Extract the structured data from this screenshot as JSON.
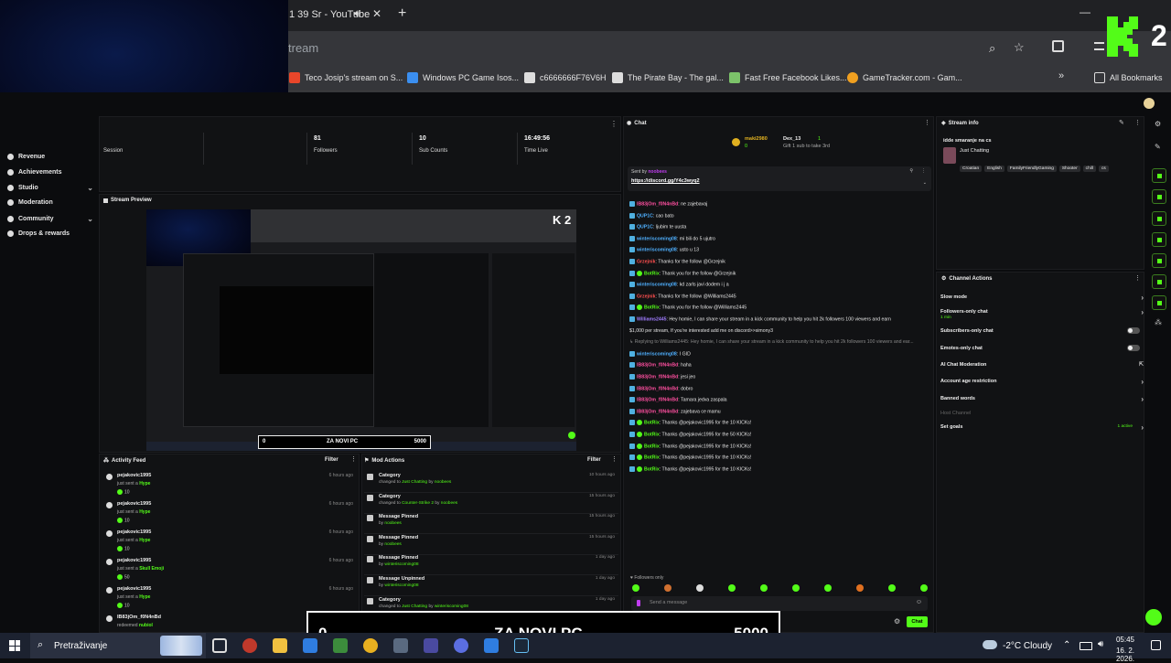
{
  "browser": {
    "tab_title": "1 39 Sr - YouTube",
    "address_partial": "tream",
    "bookmarks": [
      "Teco Josip's stream on S...",
      "Windows PC Game Isos...",
      "c6666666F76V6H",
      "The Pirate Bay - The gal...",
      "Fast Free Facebook Likes...",
      "GameTracker.com - Gam..."
    ],
    "all_bookmarks": "All Bookmarks",
    "kick_badge": "2"
  },
  "sidebar": {
    "items": [
      {
        "label": "Revenue"
      },
      {
        "label": "Achievements"
      },
      {
        "label": "Studio"
      },
      {
        "label": "Moderation"
      },
      {
        "label": "Community"
      },
      {
        "label": "Drops & rewards"
      }
    ]
  },
  "stats": {
    "session_label": "Session",
    "followers_value": "81",
    "followers_label": "Followers",
    "subs_value": "10",
    "subs_label": "Sub Counts",
    "time_value": "16:49:56",
    "time_label": "Time Live"
  },
  "preview": {
    "title": "Stream Preview",
    "overlay_left": "0",
    "overlay_mid": "ZA NOVI PC",
    "overlay_right": "5000"
  },
  "activity": {
    "title": "Activity Feed",
    "filter": "Filter",
    "items": [
      {
        "name": "pejakovic1995",
        "action": "just sent a",
        "item": "Hype",
        "amount": "10",
        "time": "6 hours ago"
      },
      {
        "name": "pejakovic1995",
        "action": "just sent a",
        "item": "Hype",
        "amount": "10",
        "time": "6 hours ago"
      },
      {
        "name": "pejakovic1995",
        "action": "just sent a",
        "item": "Hype",
        "amount": "10",
        "time": "6 hours ago"
      },
      {
        "name": "pejakovic1995",
        "action": "just sent a",
        "item": "Skull Emoji",
        "amount": "50",
        "time": "6 hours ago"
      },
      {
        "name": "pejakovic1995",
        "action": "just sent a",
        "item": "Hype",
        "amount": "10",
        "time": "6 hours ago"
      },
      {
        "name": "lB83jOm_f0N4nBd",
        "action": "redeemed",
        "item": "nubiol",
        "amount": "",
        "time": "12 hours ago"
      }
    ]
  },
  "mod_actions": {
    "title": "Mod Actions",
    "filter": "Filter",
    "items": [
      {
        "title": "Category",
        "pre": "changed to",
        "target": "Just Chatting",
        "by": "by",
        "user": "noobees",
        "time": "10 hours ago"
      },
      {
        "title": "Category",
        "pre": "changed to",
        "target": "Counter-Strike 2",
        "by": "by",
        "user": "noobees",
        "time": "15 hours ago"
      },
      {
        "title": "Message Pinned",
        "pre": "by",
        "target": "noobees",
        "by": "",
        "user": "",
        "time": "15 hours ago"
      },
      {
        "title": "Message Pinned",
        "pre": "by",
        "target": "noobees",
        "by": "",
        "user": "",
        "time": "15 hours ago"
      },
      {
        "title": "Message Pinned",
        "pre": "by",
        "target": "winteriscoming08",
        "by": "",
        "user": "",
        "time": "1 day ago"
      },
      {
        "title": "Message Unpinned",
        "pre": "by",
        "target": "winteriscoming08",
        "by": "",
        "user": "",
        "time": "1 day ago"
      },
      {
        "title": "Category",
        "pre": "changed to",
        "target": "Just Chatting",
        "by": "by",
        "user": "winteriscoming08",
        "time": "1 day ago"
      },
      {
        "title": "Category",
        "pre": "changed to",
        "target": "Counter-Strike 2",
        "by": "by",
        "user": "winteriscoming08",
        "time": "1 day ago"
      }
    ]
  },
  "chat": {
    "title": "Chat",
    "gifter_name": "maki2980",
    "gifter_count": "0",
    "gifter_name2": "Dex_13",
    "gifter_count2": "1",
    "gift_note": "Gift 1 sub to take 3rd",
    "pinned_label": "Sent by",
    "pinned_user": "noobees",
    "pinned_link": "https://discord.gg/Y4c3wyq2",
    "lines": [
      {
        "user": "lB83jOm_f0N4nBd",
        "color": "#ff4fa0",
        "text": ": ne zajebavaj"
      },
      {
        "user": "QUP1C",
        "color": "#4fb0ff",
        "text": ": cao bato"
      },
      {
        "user": "QUP1C",
        "color": "#4fb0ff",
        "text": ": ljubim te uusta"
      },
      {
        "user": "winteriscoming08",
        "color": "#4fb0ff",
        "text": ": mi bili do 5 ujutro"
      },
      {
        "user": "winteriscoming08",
        "color": "#4fb0ff",
        "text": ": usto u 13"
      },
      {
        "user": "Grzejnik",
        "color": "#ff4f4f",
        "text": ": Thanks for the follow @Grzejnik"
      },
      {
        "user": "BotRix",
        "color": "#53fc18",
        "text": ": Thank you for the follow @Grzejnik"
      },
      {
        "user": "winteriscoming08",
        "color": "#4fb0ff",
        "text": ": kd zarls javi dodem i j a"
      },
      {
        "user": "Grzejnik",
        "color": "#ff4f4f",
        "text": ": Thanks for the follow @Williams2445"
      },
      {
        "user": "BotRix",
        "color": "#53fc18",
        "text": ": Thank you for the follow @Williams2445"
      },
      {
        "user": "Williams2445",
        "color": "#a07cff",
        "text": ": Hey homie, I can share your stream in a kick community to help you hit 2k followers 100 viewers and earn"
      },
      {
        "user": "",
        "color": "#e6e6e6",
        "text": "$1,000 per stream, If you're interested add me on discord>>simony3"
      },
      {
        "user": "",
        "color": "#888888",
        "text": "↳ Replying to Williams2445: Hey homie, I can share your stream in a kick community to help you hit 2k followers 100 viewers and ear..."
      },
      {
        "user": "winteriscoming08",
        "color": "#4fb0ff",
        "text": ": I GID"
      },
      {
        "user": "lB83jOm_f0N4nBd",
        "color": "#ff4fa0",
        "text": ": haha"
      },
      {
        "user": "lB83jOm_f0N4nBd",
        "color": "#ff4fa0",
        "text": ": jesi jeo"
      },
      {
        "user": "lB83jOm_f0N4nBd",
        "color": "#ff4fa0",
        "text": ": dobro"
      },
      {
        "user": "lB83jOm_f0N4nBd",
        "color": "#ff4fa0",
        "text": ": Tamara jedva zaspala"
      },
      {
        "user": "lB83jOm_f0N4nBd",
        "color": "#ff4fa0",
        "text": ": zajebava ce mamu"
      },
      {
        "user": "BotRix",
        "color": "#53fc18",
        "text": ": Thanks @pejakovic1995 for the 10 KICKs!"
      },
      {
        "user": "BotRix",
        "color": "#53fc18",
        "text": ": Thanks @pejakovic1995 for the 50 KICKs!"
      },
      {
        "user": "BotRix",
        "color": "#53fc18",
        "text": ": Thanks @pejakovic1995 for the 10 KICKs!"
      },
      {
        "user": "BotRix",
        "color": "#53fc18",
        "text": ": Thanks @pejakovic1995 for the 10 KICKs!"
      },
      {
        "user": "BotRix",
        "color": "#53fc18",
        "text": ": Thanks @pejakovic1995 for the 10 KICKs!"
      }
    ],
    "followers_only": "Followers only",
    "placeholder": "Send a message",
    "count_left": "00",
    "count_right": "0",
    "send_label": "Chat"
  },
  "stream_info": {
    "title": "Stream info",
    "stream_title": "idde smaranje na cs",
    "category": "Just Chatting",
    "tags": [
      "Croatian",
      "English",
      "FamilyFriendlyGaming",
      "Shooter",
      "chill",
      "cs"
    ]
  },
  "channel_actions": {
    "title": "Channel Actions",
    "items": [
      {
        "label": "Slow mode",
        "sub": ""
      },
      {
        "label": "Followers-only chat",
        "sub": "1 min"
      },
      {
        "label": "Subscribers-only chat",
        "sub": ""
      },
      {
        "label": "Emotes-only chat",
        "sub": ""
      },
      {
        "label": "AI Chat Moderation",
        "sub": ""
      },
      {
        "label": "Account age restriction",
        "sub": ""
      },
      {
        "label": "Banned words",
        "sub": ""
      },
      {
        "label": "Host Channel",
        "sub": ""
      },
      {
        "label": "Set goals",
        "sub": "1 active"
      }
    ]
  },
  "taskbar": {
    "search": "Pretraživanje",
    "weather": "-2°C  Cloudy",
    "time": "05:45",
    "date": "16. 2. 2026."
  },
  "overlay": {
    "left": "0",
    "mid": "ZA NOVI PC",
    "right": "5000"
  }
}
